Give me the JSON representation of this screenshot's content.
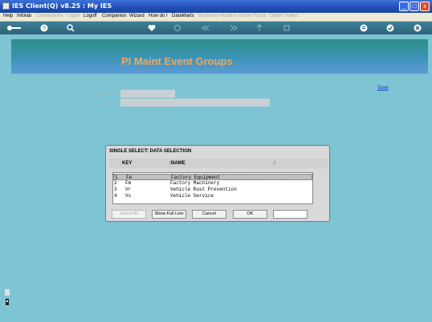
{
  "window": {
    "title": "IES Client(Q) v8.25 : My IES",
    "controls": [
      "_",
      "□",
      "x"
    ]
  },
  "menu": [
    {
      "label": "Help",
      "enabled": true
    },
    {
      "label": "Infolab",
      "enabled": true
    },
    {
      "label": "Connections",
      "enabled": false
    },
    {
      "label": "Logon",
      "enabled": false
    },
    {
      "label": "Logoff",
      "enabled": true
    },
    {
      "label": "Companion",
      "enabled": true
    },
    {
      "label": "Wizard",
      "enabled": true
    },
    {
      "label": "How do I",
      "enabled": true
    },
    {
      "label": "DataMarts",
      "enabled": true
    },
    {
      "label": "Business Modules",
      "enabled": false
    },
    {
      "label": "Action Focus",
      "enabled": false
    },
    {
      "label": "Option Select",
      "enabled": false
    }
  ],
  "toolbar": {
    "icons": [
      "key-icon",
      "help-icon",
      "search-icon",
      "heart-icon",
      "refresh-icon",
      "rewind-icon",
      "forward-icon",
      "up-icon",
      "stop-icon",
      "menu-icon",
      "check-icon",
      "close-icon"
    ]
  },
  "page": {
    "title": "PI Maint Event Groups",
    "save_link": "Save",
    "fields": {
      "group_key_label": "Group Key",
      "group_key_value": "",
      "name_label": "Name",
      "name_value": ""
    }
  },
  "dialog": {
    "title": "SINGLE SELECT: DATA SELECTION",
    "headers": {
      "key": "KEY",
      "name": ":NAME",
      "extra": ":"
    },
    "rows": [
      {
        "num": "1",
        "key": "Fe",
        "name": "Factory Equipment",
        "selected": true
      },
      {
        "num": "2",
        "key": "Fm",
        "name": "Factory Machinery",
        "selected": false
      },
      {
        "num": "3",
        "key": "Vr",
        "name": "Vehicle Rust Prevention",
        "selected": false
      },
      {
        "num": "4",
        "key": "Vs",
        "name": "Vehicle Service",
        "selected": false
      }
    ],
    "buttons": {
      "select_all": "Select All",
      "show_full_line": "Show Full Line",
      "cancel": "Cancel",
      "ok": "OK"
    },
    "search_value": ""
  }
}
